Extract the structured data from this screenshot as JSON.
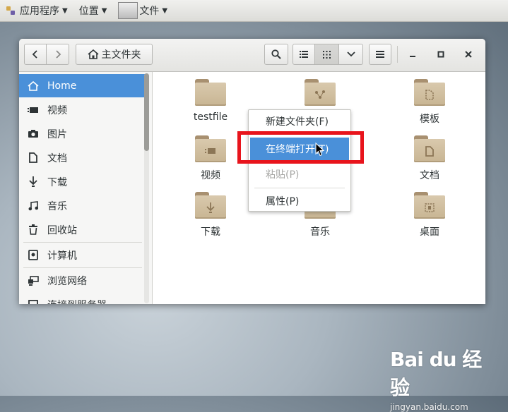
{
  "topbar": {
    "apps_label": "应用程序",
    "places_label": "位置",
    "files_label": "文件"
  },
  "header": {
    "path_label": "主文件夹"
  },
  "sidebar": {
    "items": [
      {
        "label": "Home",
        "icon": "home-icon"
      },
      {
        "label": "视频",
        "icon": "video-icon"
      },
      {
        "label": "图片",
        "icon": "camera-icon"
      },
      {
        "label": "文档",
        "icon": "document-icon"
      },
      {
        "label": "下载",
        "icon": "download-icon"
      },
      {
        "label": "音乐",
        "icon": "music-icon"
      },
      {
        "label": "回收站",
        "icon": "trash-icon"
      },
      {
        "label": "计算机",
        "icon": "computer-icon"
      },
      {
        "label": "浏览网络",
        "icon": "network-icon"
      },
      {
        "label": "连接到服务器",
        "icon": "server-icon"
      }
    ]
  },
  "files": [
    {
      "label": "testfile",
      "emblem": ""
    },
    {
      "label": "",
      "emblem": "share-icon"
    },
    {
      "label": "模板",
      "emblem": "template-icon"
    },
    {
      "label": "视频",
      "emblem": "video-icon"
    },
    {
      "label": "文档",
      "emblem": "document-icon"
    },
    {
      "label": "下载",
      "emblem": "download-icon"
    },
    {
      "label": "音乐",
      "emblem": "music-icon"
    },
    {
      "label": "桌面",
      "emblem": "desktop-icon"
    }
  ],
  "context_menu": {
    "items": [
      {
        "label": "新建文件夹(F)",
        "state": "normal"
      },
      {
        "label": "在终端打开(T)",
        "state": "highlighted"
      },
      {
        "label": "粘贴(P)",
        "state": "disabled"
      },
      {
        "label": "属性(P)",
        "state": "normal"
      }
    ]
  },
  "watermark": {
    "logo": "Bai du 经验",
    "url": "jingyan.baidu.com"
  },
  "colors": {
    "accent": "#4a90d9",
    "highlight_box": "#e8141c",
    "folder": "#d2c1a3"
  }
}
